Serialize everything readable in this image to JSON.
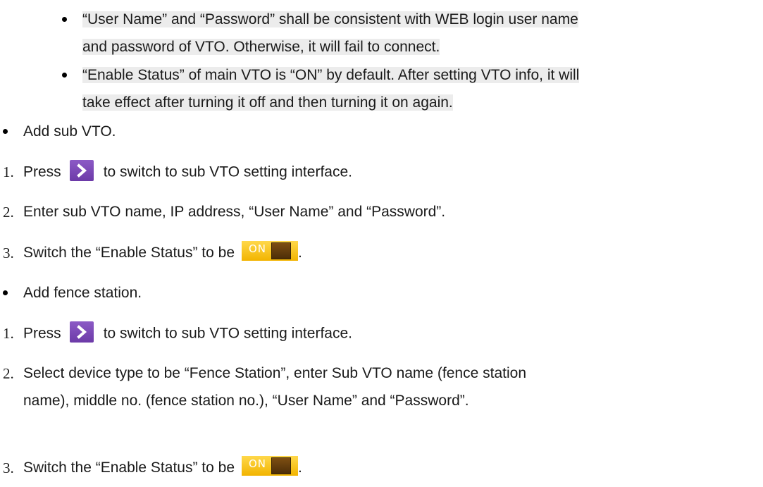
{
  "notes": [
    {
      "line1": "“User Name” and “Password” shall be consistent with WEB login user name",
      "line2": "and password of VTO. Otherwise, it will fail to connect."
    },
    {
      "line1": "“Enable Status” of main VTO is “ON” by default. After setting VTO info, it will",
      "line2": "take effect after turning it off and then turning it on again."
    }
  ],
  "sections": [
    {
      "title": "Add sub VTO.",
      "steps": [
        {
          "num": "1.",
          "pre": "Press",
          "post": "to switch to sub VTO setting interface."
        },
        {
          "num": "2.",
          "text": "Enter sub VTO name, IP address, “User Name” and “Password”."
        },
        {
          "num": "3.",
          "pre": "Switch the “Enable Status” to be",
          "post": "."
        }
      ]
    },
    {
      "title": "Add fence station.",
      "steps": [
        {
          "num": "1.",
          "pre": "Press",
          "post": "to switch to sub VTO setting interface."
        },
        {
          "num": "2.",
          "line1": "Select device type to be “Fence Station”, enter Sub VTO name (fence station",
          "line2": "name), middle no. (fence station no.), “User Name” and “Password”."
        },
        {
          "num": "3.",
          "pre": "Switch the “Enable Status” to be",
          "post": "."
        }
      ]
    }
  ],
  "icons": {
    "next": "chevron-right-icon",
    "toggle_label": "ON"
  },
  "colors": {
    "chevron_bg": "#7b49b8",
    "toggle_bg": "#f5c21a",
    "toggle_knob": "#5c3a0c",
    "highlight": "#ececec"
  }
}
